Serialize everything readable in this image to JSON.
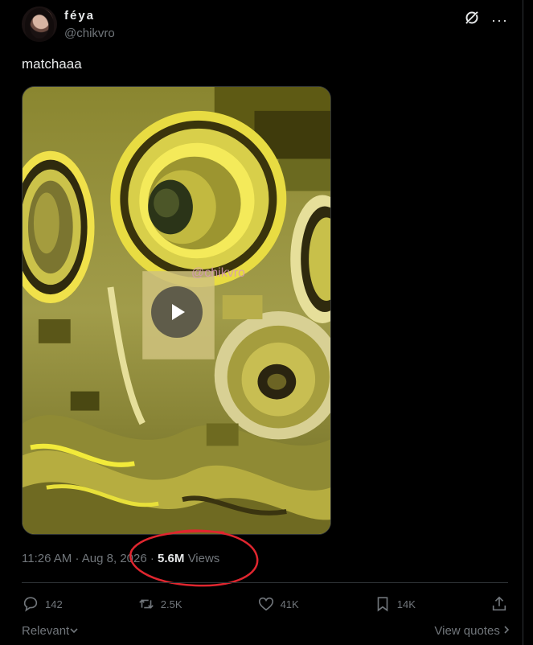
{
  "author": {
    "display_name": "féya",
    "handle": "@chikvro"
  },
  "header_icons": [
    "grok-icon",
    "more-icon"
  ],
  "more_glyph": "···",
  "tweet_text": "matchaaa",
  "media": {
    "type": "video",
    "watermark": "@chikvro",
    "play_icon": "play-icon"
  },
  "meta": {
    "time": "11:26 AM",
    "sep1": "·",
    "date": "Aug 8, 2026",
    "sep2": "·",
    "views_count": "5.6M",
    "views_label": "Views"
  },
  "annotation": {
    "type": "hand-drawn circle",
    "color": "#e0262f"
  },
  "actions": {
    "reply_count": "142",
    "repost_count": "2.5K",
    "like_count": "41K",
    "bookmark_count": "14K"
  },
  "footer": {
    "relevant": "Relevant",
    "view_quotes": "View quotes"
  },
  "colors": {
    "background": "#000000",
    "text": "#e7e9ea",
    "muted": "#71767b",
    "border": "#2f3336"
  }
}
